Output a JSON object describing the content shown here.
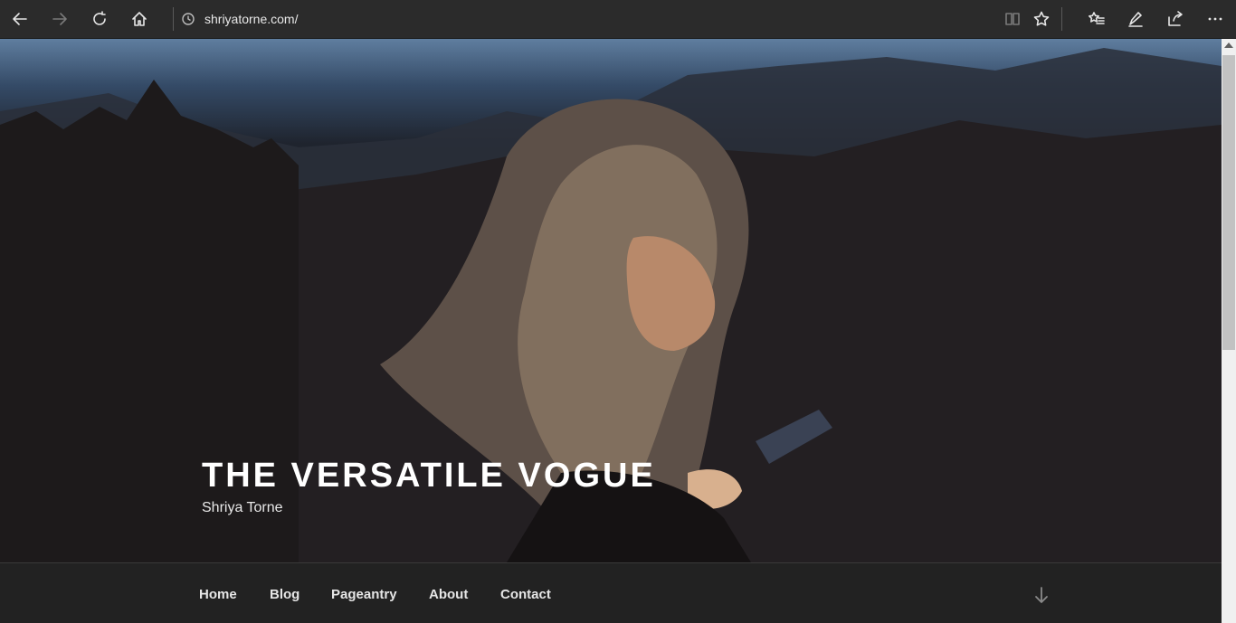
{
  "browser": {
    "url": "shriyatorne.com/",
    "icons": [
      "back-icon",
      "forward-icon",
      "refresh-icon",
      "home-icon",
      "history-icon",
      "reading-view-icon",
      "favorite-star-icon",
      "favorites-hub-icon",
      "pen-icon",
      "share-icon",
      "more-icon"
    ]
  },
  "site": {
    "title": "THE VERSATILE VOGUE",
    "description": "Shriya Torne"
  },
  "nav": {
    "items": [
      {
        "label": "Home"
      },
      {
        "label": "Blog"
      },
      {
        "label": "Pageantry"
      },
      {
        "label": "About"
      },
      {
        "label": "Contact"
      }
    ]
  },
  "colors": {
    "toolbar": "#2b2b2b",
    "navbar": "#222222",
    "title": "#ffffff"
  }
}
